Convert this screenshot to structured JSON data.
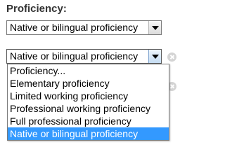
{
  "field": {
    "label": "Proficiency:"
  },
  "select_1": {
    "value": "Native or bilingual proficiency"
  },
  "select_2": {
    "value": "Native or bilingual proficiency",
    "open": true
  },
  "dropdown": {
    "options": [
      "Proficiency...",
      "Elementary proficiency",
      "Limited working proficiency",
      "Professional working proficiency",
      "Full professional proficiency",
      "Native or bilingual proficiency"
    ],
    "selected_index": 5
  },
  "icons": {
    "arrow": "chevron-down-icon",
    "remove": "remove-circle-icon"
  },
  "colors": {
    "heading_text": "#333333",
    "selection_highlight": "#3399ff",
    "selection_text": "#ffffff",
    "remove_icon": "#d4d4d4"
  }
}
